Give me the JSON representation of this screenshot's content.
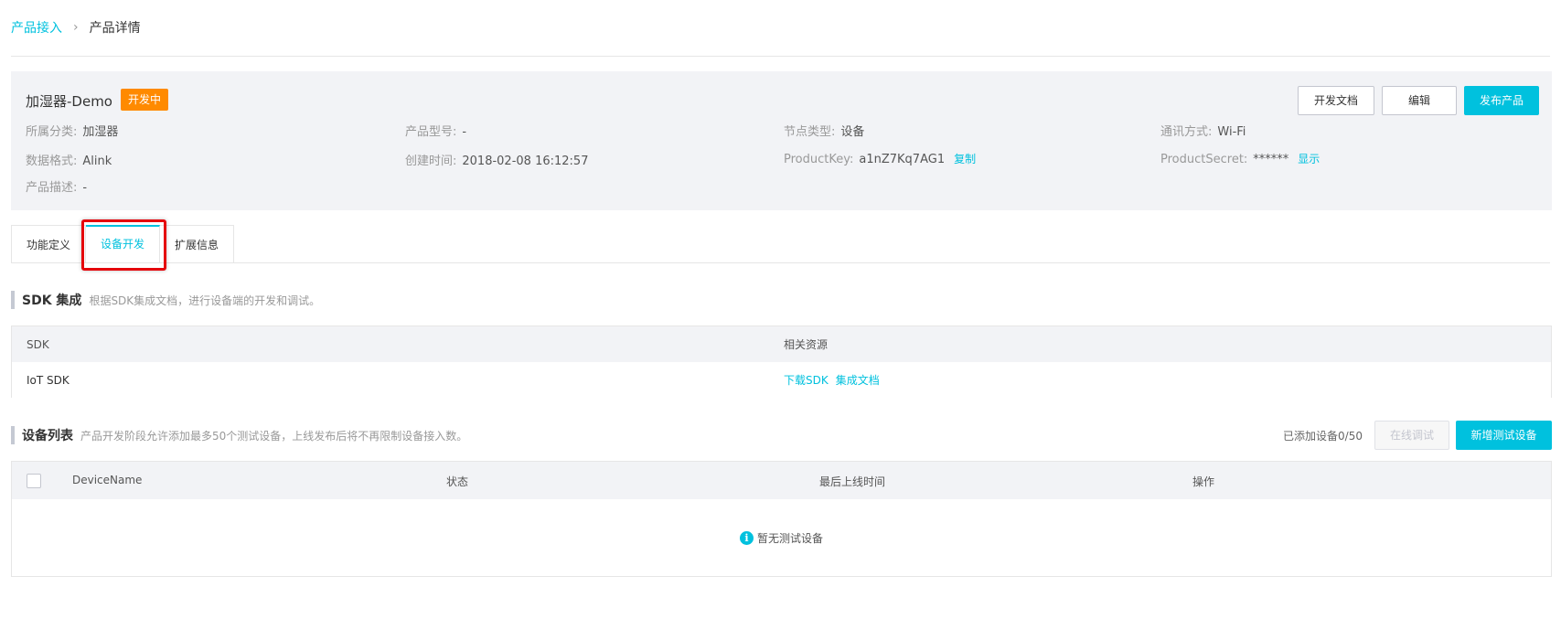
{
  "breadcrumb": {
    "parent": "产品接入",
    "separator": "›",
    "current": "产品详情"
  },
  "product": {
    "name": "加湿器-Demo",
    "status": "开发中",
    "category_label": "所属分类:",
    "category": "加湿器",
    "model_label": "产品型号:",
    "model": "-",
    "node_label": "节点类型:",
    "node": "设备",
    "comm_label": "通讯方式:",
    "comm": "Wi-Fi",
    "format_label": "数据格式:",
    "format": "Alink",
    "created_label": "创建时间:",
    "created": "2018-02-08 16:12:57",
    "key_label": "ProductKey:",
    "key": "a1nZ7Kq7AG1",
    "copy": "复制",
    "secret_label": "ProductSecret:",
    "secret": "******",
    "show": "显示",
    "desc_label": "产品描述:",
    "desc": "-"
  },
  "actions": {
    "docs": "开发文档",
    "edit": "编辑",
    "publish": "发布产品"
  },
  "tabs": [
    {
      "label": "功能定义"
    },
    {
      "label": "设备开发",
      "active": true
    },
    {
      "label": "扩展信息"
    }
  ],
  "sdk_section": {
    "title": "SDK 集成",
    "desc": "根据SDK集成文档，进行设备端的开发和调试。",
    "columns": [
      "SDK",
      "相关资源"
    ],
    "row": {
      "sdk": "IoT SDK",
      "download": "下载SDK",
      "doc": "集成文档"
    }
  },
  "device_section": {
    "title": "设备列表",
    "desc": "产品开发阶段允许添加最多50个测试设备，上线发布后将不再限制设备接入数。",
    "count": "已添加设备0/50",
    "online_debug": "在线调试",
    "add": "新增测试设备",
    "columns": [
      "DeviceName",
      "状态",
      "最后上线时间",
      "操作"
    ],
    "empty": "暂无测试设备"
  },
  "colors": {
    "accent": "#00c1de",
    "status": "#ff8a00",
    "highlight": "#e5060c"
  },
  "icons": {
    "info": "info-icon",
    "separator": "chevron-right-icon"
  }
}
